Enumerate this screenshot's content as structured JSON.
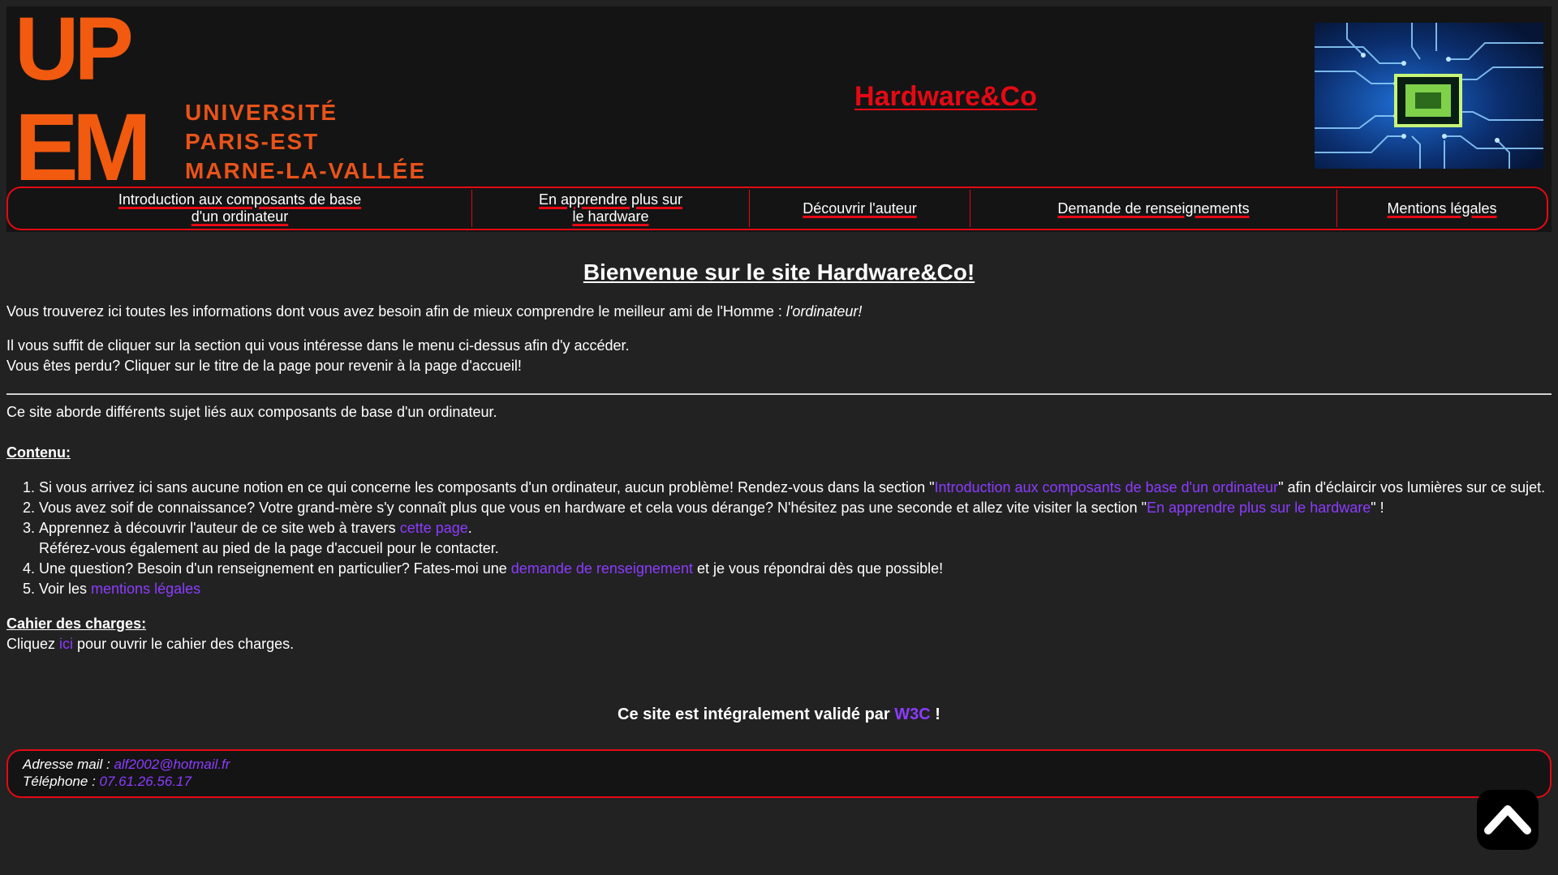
{
  "header": {
    "logo": {
      "big_letters": [
        "UP",
        "EM"
      ],
      "lines": [
        "UNIVERSITÉ",
        "PARIS-EST",
        "MARNE-LA-VALLÉE"
      ]
    },
    "site_title": "Hardware&Co",
    "brand_colors": {
      "accent_red": "#e50914",
      "logo_orange": "#f15a0f",
      "link_purple": "#8c3cff"
    },
    "chip_image": "circuit-chip-icon"
  },
  "nav": {
    "items": [
      {
        "line1": "Introduction aux composants de base",
        "line2": "d'un ordinateur"
      },
      {
        "line1": "En apprendre plus sur",
        "line2": "le hardware"
      },
      {
        "line1": "Découvrir l'auteur",
        "line2": ""
      },
      {
        "line1": "Demande de renseignements",
        "line2": ""
      },
      {
        "line1": "Mentions légales",
        "line2": ""
      }
    ]
  },
  "main": {
    "heading": "Bienvenue sur le site Hardware&Co!",
    "intro": "Vous trouverez ici toutes les informations dont vous avez besoin afin de mieux comprendre le meilleur ami de l'Homme : ",
    "intro_em": "l'ordinateur!",
    "hint_line1": "Il vous suffit de cliquer sur la section qui vous intéresse dans le menu ci-dessus afin d'y accéder.",
    "hint_line2": "Vous êtes perdu? Cliquer sur le titre de la page pour revenir à la page d'accueil!",
    "topics": "Ce site aborde différents sujet liés aux composants de base d'un ordinateur.",
    "contenu_title": "Contenu:",
    "list": [
      {
        "before": "Si vous arrivez ici sans aucune notion en ce qui concerne les composants d'un ordinateur, aucun problème! Rendez-vous dans la section \"",
        "link": "Introduction aux composants de base d'un ordinateur",
        "after": "\" afin d'éclaircir vos lumières sur ce sujet."
      },
      {
        "before": "Vous avez soif de connaissance? Votre grand-mère s'y connaît plus que vous en hardware et cela vous dérange? N'hésitez pas une seconde et allez vite visiter la section \"",
        "link": "En apprendre plus sur le hardware",
        "after": "\" !"
      },
      {
        "before": "Apprennez à découvrir l'auteur de ce site web à travers ",
        "link": "cette page",
        "after": ".",
        "extra": "Référez-vous également au pied de la page d'accueil pour le contacter."
      },
      {
        "before": "Une question? Besoin d'un renseignement en particulier? Fates-moi une ",
        "link": "demande de renseignement",
        "after": " et je vous répondrai dès que possible!"
      },
      {
        "before": "Voir les ",
        "link": "mentions légales",
        "after": ""
      }
    ],
    "cahier_title": "Cahier des charges:",
    "cahier_before": "Cliquez ",
    "cahier_link": "ici",
    "cahier_after": " pour ouvrir le cahier des charges.",
    "w3c_before": "Ce site est intégralement validé par ",
    "w3c_link": "W3C",
    "w3c_after": " !"
  },
  "footer": {
    "email_label": "Adresse mail : ",
    "email": "alf2002@hotmail.fr",
    "phone_label": "Téléphone : ",
    "phone": "07.61.26.56.17"
  },
  "to_top_icon": "chevron-up-icon"
}
